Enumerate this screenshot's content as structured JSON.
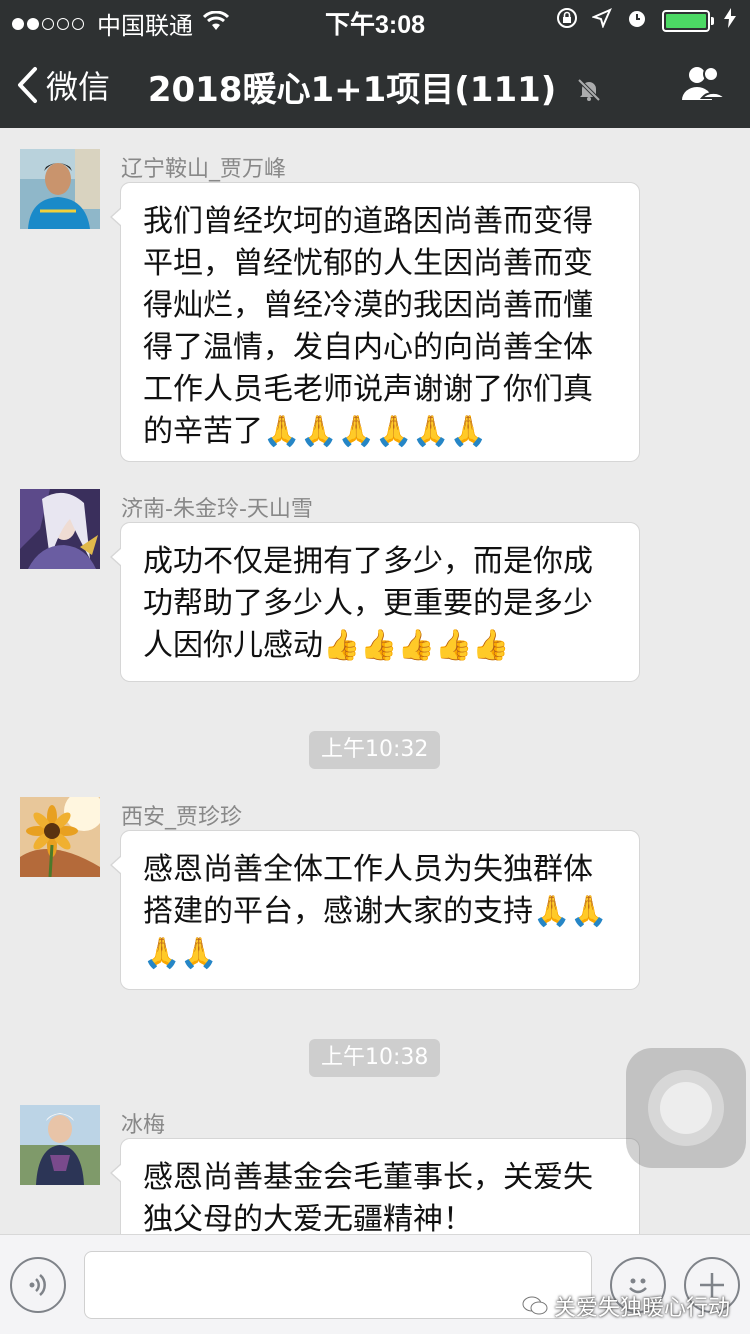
{
  "status_bar": {
    "carrier": "中国联通",
    "time": "下午3:08",
    "battery_level": 1.0
  },
  "nav": {
    "back_label": "微信",
    "title": "2018暖心1+1项目(111)"
  },
  "messages": [
    {
      "sender": "辽宁鞍山_贾万峰",
      "text": "我们曾经坎坷的道路因尚善而变得平坦，曾经忧郁的人生因尚善而变得灿烂，曾经冷漠的我因尚善而懂得了温情，发自内心的向尚善全体工作人员毛老师说声谢谢了你们真的辛苦了🙏🙏🙏🙏🙏🙏"
    },
    {
      "sender": "济南-朱金玲-天山雪",
      "text": "成功不仅是拥有了多少，而是你成功帮助了多少人，更重要的是多少人因你儿感动👍👍👍👍👍"
    },
    {
      "sender": "西安_贾珍珍",
      "text": "感恩尚善全体工作人员为失独群体搭建的平台，感谢大家的支持🙏🙏🙏🙏"
    },
    {
      "sender": "冰梅",
      "text": "感恩尚善基金会毛董事长，关爱失独父母的大爱无疆精神！"
    }
  ],
  "timestamps": [
    "上午10:32",
    "上午10:38"
  ],
  "watermark": "关爱失独暖心行动",
  "colors": {
    "nav_bg": "#2e3132",
    "chat_bg": "#ebebeb",
    "timestamp_bg": "#cecece",
    "battery_fill": "#4cd964"
  }
}
